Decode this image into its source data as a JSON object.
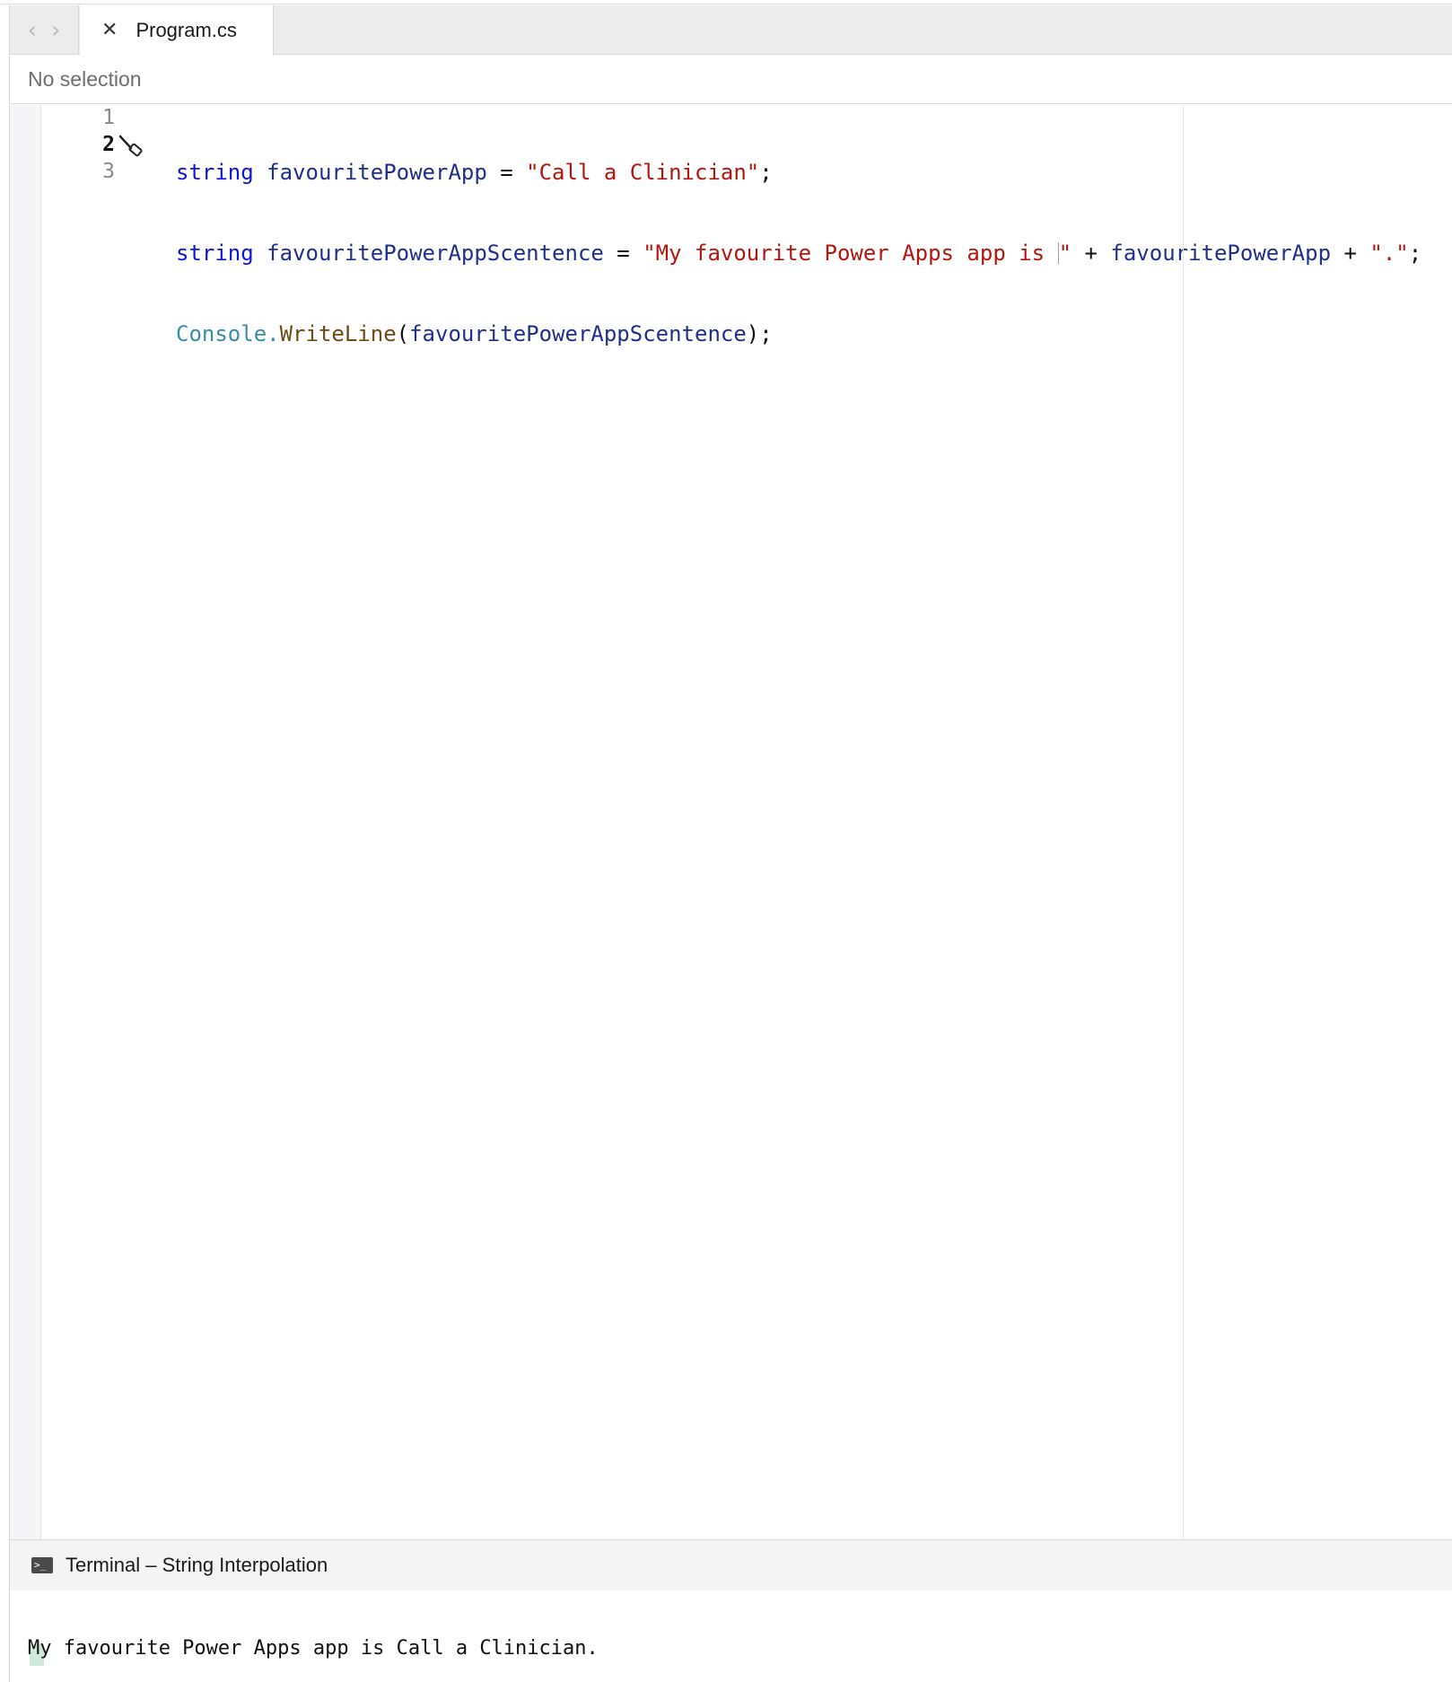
{
  "tabs": {
    "back_arrow": "‹",
    "forward_arrow": "›",
    "close_glyph": "✕",
    "active_file": "Program.cs"
  },
  "selection_bar": {
    "text": "No selection"
  },
  "editor": {
    "line_numbers": [
      "1",
      "2",
      "3"
    ],
    "line1": {
      "kw": "string",
      "var": "favouritePowerApp",
      "op": " = ",
      "str": "\"Call a Clinician\"",
      "end": ";"
    },
    "line2": {
      "kw": "string",
      "var": "favouritePowerAppScentence",
      "op": " = ",
      "str": "\"My favourite Power Apps app is ",
      "str_close": "\"",
      "plus1": " + ",
      "var2": "favouritePowerApp",
      "plus2": " + ",
      "str2": "\".\"",
      "end": ";"
    },
    "line3": {
      "type": "Console",
      "dot": ".",
      "method": "WriteLine",
      "open": "(",
      "arg": "favouritePowerAppScentence",
      "close": ");"
    },
    "gutter_icon": "hammer-icon",
    "colors": {
      "keyword": "#0f14d6",
      "identifier": "#1f2f8a",
      "string": "#b2160f",
      "type": "#3a8ca8",
      "method": "#6c4b14"
    }
  },
  "terminal": {
    "icon_glyph": ">_",
    "title": "Terminal – String Interpolation",
    "output": "My favourite Power Apps app is Call a Clinician."
  }
}
